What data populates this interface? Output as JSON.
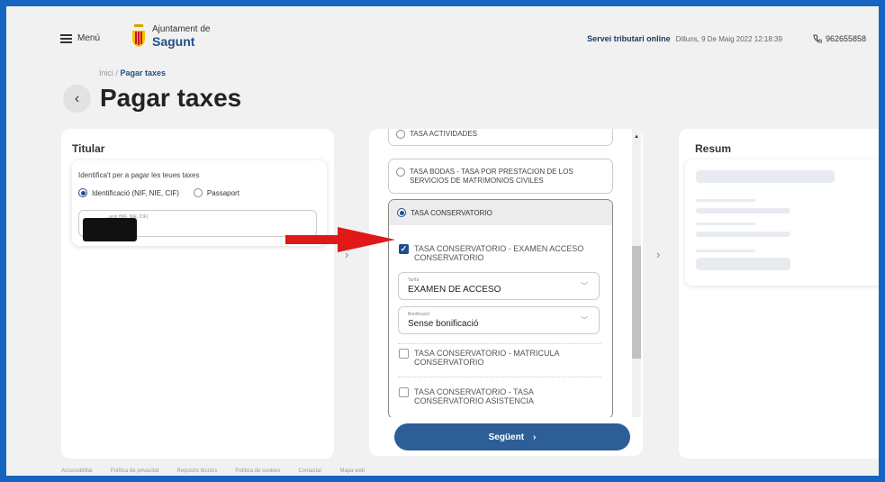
{
  "header": {
    "menu_label": "Menú",
    "logo_line1": "Ajuntament de",
    "logo_line2": "Sagunt",
    "online_label": "Servei tributari online",
    "datetime": "Dilluns, 9 De Maig 2022 12:18:39",
    "phone": "962655858"
  },
  "breadcrumb": {
    "home": "Inici",
    "separator": " / ",
    "current": "Pagar taxes"
  },
  "page_title": "Pagar taxes",
  "titular": {
    "title": "Titular",
    "intro": "Identifica't per a pagar les teues taxes",
    "radio_id_label": "Identificació (NIF, NIE, CIF)",
    "radio_passport_label": "Passaport",
    "input_label": "...ació (NIF, NIE, CIF)"
  },
  "taxes": {
    "option1": "TASA ACTIVIDADES",
    "option2": "TASA BODAS - TASA POR PRESTACION DE LOS SERVICIOS DE MATRIMONIOS CIVILES",
    "option3": "TASA CONSERVATORIO",
    "sub1": "TASA CONSERVATORIO - EXAMEN ACCESO CONSERVATORIO",
    "tarifa_label": "Tarifa",
    "tarifa_value": "EXAMEN DE ACCESO",
    "bonif_label": "Bonificació",
    "bonif_value": "Sense bonificació",
    "sub2": "TASA CONSERVATORIO - MATRICULA CONSERVATORIO",
    "sub3": "TASA CONSERVATORIO - TASA CONSERVATORIO ASISTENCIA",
    "next_label": "Següent"
  },
  "resum": {
    "title": "Resum"
  },
  "footer": {
    "links": [
      "Accessibilitat",
      "Política de privacitat",
      "Requisits tècnics",
      "Política de cookies",
      "Contactar",
      "Mapa web"
    ]
  },
  "colors": {
    "frame_border": "#1565c0",
    "brand_blue": "#1f4e8c",
    "button_blue": "#2d5f96",
    "arrow_red": "#e01818"
  }
}
